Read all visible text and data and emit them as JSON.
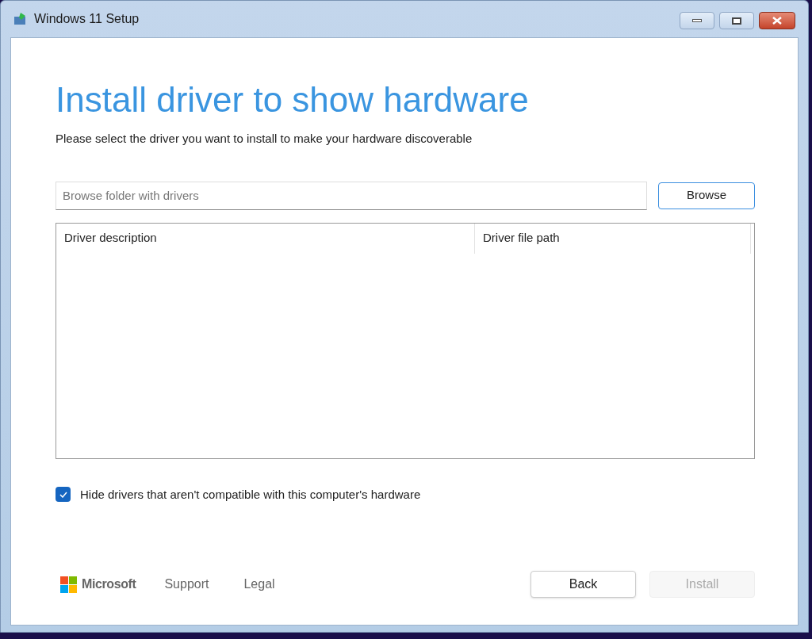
{
  "window": {
    "title": "Windows 11 Setup"
  },
  "heading": "Install driver to show hardware",
  "subtitle": "Please select the driver you want to install to make your hardware discoverable",
  "folder_field": {
    "placeholder": "Browse folder with drivers"
  },
  "browse_button": "Browse",
  "table": {
    "columns": [
      "Driver description",
      "Driver file path"
    ]
  },
  "hide_incompatible": {
    "label": "Hide drivers that aren't compatible with this computer's hardware",
    "checked": true
  },
  "footer": {
    "brand": "Microsoft",
    "links": [
      "Support",
      "Legal"
    ]
  },
  "buttons": [
    {
      "label": "Back",
      "disabled": false
    },
    {
      "label": "Install",
      "disabled": true
    }
  ]
}
